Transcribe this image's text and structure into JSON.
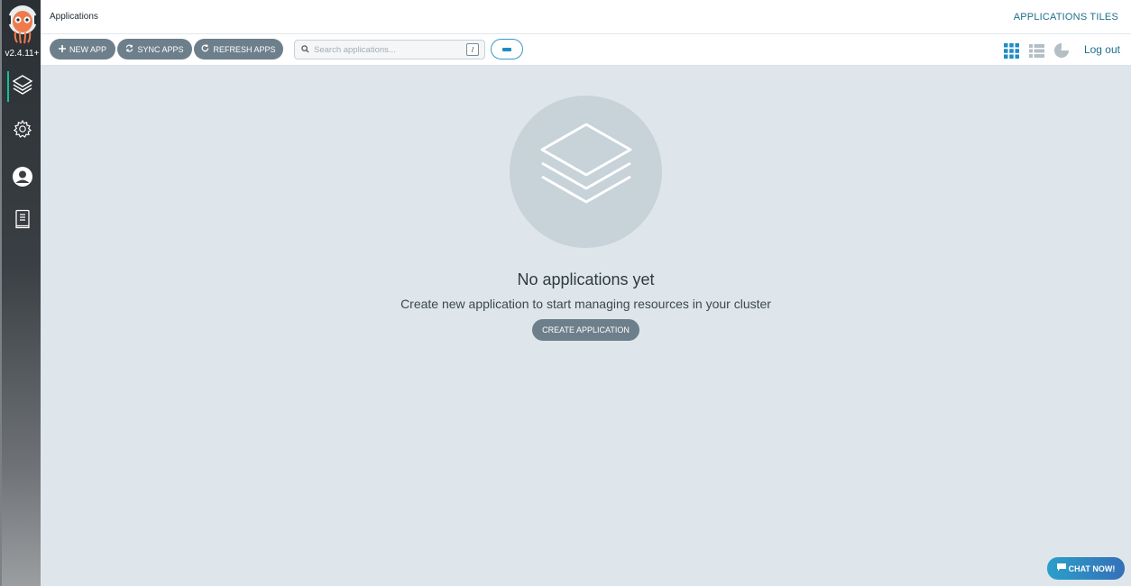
{
  "sidebar": {
    "version": "v2.4.11+",
    "logo_icon": "argo-octopus-logo",
    "items": [
      {
        "icon": "layers-icon",
        "active": true
      },
      {
        "icon": "gear-icon",
        "active": false
      },
      {
        "icon": "user-icon",
        "active": false
      },
      {
        "icon": "docs-icon",
        "active": false
      }
    ],
    "active_accent": "#18be94"
  },
  "topbar": {
    "title": "Applications",
    "right_title": "APPLICATIONS TILES"
  },
  "toolbar": {
    "new_app_label": "NEW APP",
    "sync_apps_label": "SYNC APPS",
    "refresh_apps_label": "REFRESH APPS",
    "search_placeholder": "Search applications...",
    "search_shortcut": "/",
    "view_modes": [
      "tiles-view-icon",
      "list-view-icon",
      "summary-pie-icon"
    ],
    "active_view": "tiles",
    "logout_label": "Log out"
  },
  "empty_state": {
    "title": "No applications yet",
    "subtitle": "Create new application to start managing resources in your cluster",
    "button_label": "CREATE APPLICATION"
  },
  "chat": {
    "label": "CHAT NOW!"
  },
  "colors": {
    "button_bg": "#6d7f8b",
    "link": "#1f6f8b",
    "main_bg": "#dee6eb",
    "accent_blue": "#1f8cc3"
  }
}
